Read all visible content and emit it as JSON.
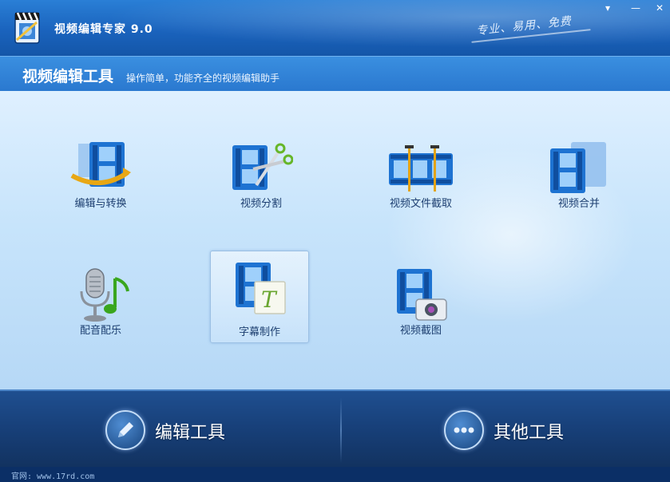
{
  "window": {
    "title": "视频编辑专家 9.0",
    "slogan": "专业、易用、免费",
    "menu_button": "▾",
    "minimize_button": "—",
    "close_button": "✕"
  },
  "header": {
    "title": "视频编辑工具",
    "subtitle": "操作简单，功能齐全的视频编辑助手"
  },
  "tools": [
    {
      "label": "编辑与转换",
      "icon": "film-convert-icon",
      "selected": false
    },
    {
      "label": "视频分割",
      "icon": "film-scissors-icon",
      "selected": false
    },
    {
      "label": "视频文件截取",
      "icon": "film-clip-icon",
      "selected": false
    },
    {
      "label": "视频合并",
      "icon": "film-merge-icon",
      "selected": false
    },
    {
      "label": "配音配乐",
      "icon": "microphone-music-icon",
      "selected": false
    },
    {
      "label": "字幕制作",
      "icon": "subtitle-icon",
      "selected": true
    },
    {
      "label": "视频截图",
      "icon": "film-camera-icon",
      "selected": false
    }
  ],
  "bottom_nav": {
    "edit_tools": "编辑工具",
    "other_tools": "其他工具"
  },
  "status": {
    "text": "官网: www.17rd.com"
  },
  "colors": {
    "titlebar": "#1a63bd",
    "header": "#2a78cf",
    "bottom": "#173f78",
    "film_blue": "#1e73d2"
  }
}
